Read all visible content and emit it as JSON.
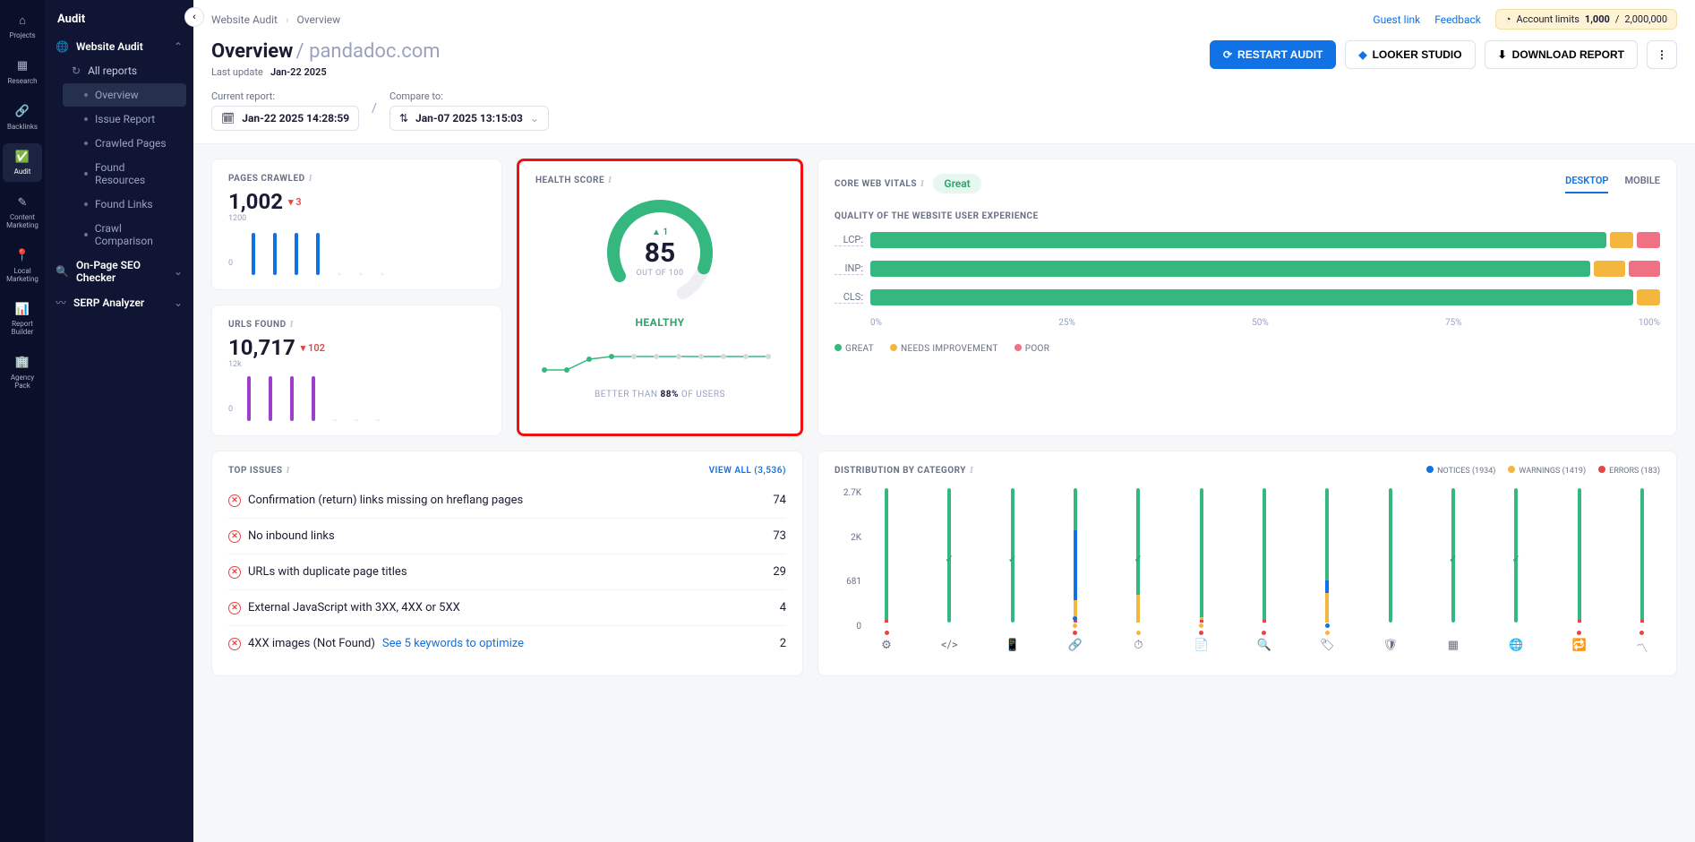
{
  "rail": [
    {
      "id": "projects",
      "label": "Projects"
    },
    {
      "id": "research",
      "label": "Research"
    },
    {
      "id": "backlinks",
      "label": "Backlinks"
    },
    {
      "id": "audit",
      "label": "Audit",
      "active": true
    },
    {
      "id": "content-marketing",
      "label": "Content\nMarketing"
    },
    {
      "id": "local-marketing",
      "label": "Local\nMarketing"
    },
    {
      "id": "report-builder",
      "label": "Report\nBuilder"
    },
    {
      "id": "agency-pack",
      "label": "Agency\nPack"
    }
  ],
  "sidebar": {
    "title": "Audit",
    "sections": [
      {
        "label": "Website Audit",
        "icon": "globe",
        "expanded": true,
        "children": [
          {
            "label": "All reports"
          },
          {
            "label": "Overview",
            "active": true
          },
          {
            "label": "Issue Report"
          },
          {
            "label": "Crawled Pages"
          },
          {
            "label": "Found Resources"
          },
          {
            "label": "Found Links"
          },
          {
            "label": "Crawl Comparison"
          }
        ]
      },
      {
        "label": "On-Page SEO Checker",
        "icon": "search",
        "expanded": false
      },
      {
        "label": "SERP Analyzer",
        "icon": "chart",
        "expanded": false
      }
    ]
  },
  "breadcrumb": {
    "a": "Website Audit",
    "b": "Overview"
  },
  "top_links": {
    "guest": "Guest link",
    "feedback": "Feedback"
  },
  "limits": {
    "label": "Account limits",
    "used": "1,000",
    "total": "2,000,000"
  },
  "title": {
    "page": "Overview",
    "domain": "pandadoc.com"
  },
  "last_update": {
    "label": "Last update",
    "value": "Jan-22 2025"
  },
  "actions": {
    "restart": "RESTART AUDIT",
    "looker": "LOOKER STUDIO",
    "download": "DOWNLOAD REPORT"
  },
  "filters": {
    "current_label": "Current report:",
    "current_value": "Jan-22 2025 14:28:59",
    "compare_label": "Compare to:",
    "compare_value": "Jan-07 2025 13:15:03"
  },
  "pages_crawled": {
    "title": "PAGES CRAWLED",
    "value": "1,002",
    "delta": "3",
    "delta_dir": "down",
    "y_top": "1200",
    "y_bot": "0"
  },
  "urls_found": {
    "title": "URLS FOUND",
    "value": "10,717",
    "delta": "102",
    "delta_dir": "down",
    "y_top": "12k",
    "y_bot": "0"
  },
  "health": {
    "title": "HEALTH SCORE",
    "tick": "▲ 1",
    "score": "85",
    "out_of": "OUT OF 100",
    "status": "HEALTHY",
    "better_prefix": "BETTER THAN ",
    "better_pct": "88%",
    "better_suffix": " OF USERS"
  },
  "cwv": {
    "title": "CORE WEB VITALS",
    "badge": "Great",
    "tabs": {
      "desktop": "DESKTOP",
      "mobile": "MOBILE"
    },
    "subtitle": "QUALITY OF THE WEBSITE USER EXPERIENCE",
    "rows": [
      {
        "label": "LCP:",
        "great": 94,
        "ni": 3,
        "poor": 3
      },
      {
        "label": "INP:",
        "great": 92,
        "ni": 4,
        "poor": 4
      },
      {
        "label": "CLS:",
        "great": 97,
        "ni": 3,
        "poor": 0
      }
    ],
    "axis": [
      "0%",
      "25%",
      "50%",
      "75%",
      "100%"
    ],
    "legend": {
      "great": "GREAT",
      "ni": "NEEDS IMPROVEMENT",
      "poor": "POOR"
    }
  },
  "issues": {
    "title": "TOP ISSUES",
    "view_all": "VIEW ALL (3,536)",
    "rows": [
      {
        "text": "Confirmation (return) links missing on hreflang pages",
        "count": "74"
      },
      {
        "text": "No inbound links",
        "count": "73"
      },
      {
        "text": "URLs with duplicate page titles",
        "count": "29"
      },
      {
        "text": "External JavaScript with 3XX, 4XX or 5XX",
        "count": "4"
      },
      {
        "text": "4XX images (Not Found)",
        "link": "See 5 keywords to optimize",
        "count": "2"
      }
    ]
  },
  "dist": {
    "title": "DISTRIBUTION BY CATEGORY",
    "legend": {
      "notices": "NOTICES (1934)",
      "warnings": "WARNINGS (1419)",
      "errors": "ERRORS (183)"
    },
    "yaxis": [
      "2.7K",
      "2K",
      "681",
      "0"
    ],
    "colors": {
      "errors": "#e64545",
      "warnings": "#f4b63f",
      "notices": "#1072e5",
      "bg": "#35b880"
    }
  },
  "chart_data": [
    {
      "type": "bar",
      "title": "Pages Crawled",
      "ylim": [
        0,
        1200
      ],
      "categories": [
        "1",
        "2",
        "3",
        "4",
        "5",
        "6",
        "7"
      ],
      "values": [
        1000,
        1005,
        1005,
        1002,
        0,
        0,
        0
      ],
      "color": "#1072e5"
    },
    {
      "type": "bar",
      "title": "URLs Found",
      "ylim": [
        0,
        12000
      ],
      "categories": [
        "1",
        "2",
        "3",
        "4",
        "5",
        "6",
        "7"
      ],
      "values": [
        10800,
        10800,
        10800,
        10717,
        0,
        0,
        0
      ],
      "color": "#9b3fcf"
    },
    {
      "type": "line",
      "title": "Health Score trend",
      "ylim": [
        80,
        90
      ],
      "x": [
        1,
        2,
        3,
        4,
        5,
        6,
        7,
        8,
        9,
        10,
        11,
        12
      ],
      "values": [
        82,
        82,
        84,
        85,
        85,
        85,
        85,
        85,
        85,
        85,
        85,
        85
      ]
    },
    {
      "type": "stacked_bar",
      "title": "Distribution by Category",
      "ylim": [
        0,
        2700
      ],
      "categories": [
        "structure",
        "code",
        "mobile",
        "links",
        "performance",
        "content",
        "search",
        "tags",
        "security",
        "markup",
        "international",
        "cache",
        "trend"
      ],
      "series": [
        {
          "name": "errors",
          "values": [
            30,
            0,
            0,
            30,
            0,
            40,
            50,
            0,
            0,
            0,
            0,
            20,
            30
          ]
        },
        {
          "name": "warnings",
          "values": [
            0,
            0,
            0,
            400,
            550,
            50,
            0,
            600,
            0,
            0,
            0,
            0,
            0
          ]
        },
        {
          "name": "notices",
          "values": [
            0,
            0,
            0,
            1400,
            0,
            0,
            0,
            250,
            0,
            0,
            0,
            0,
            0
          ]
        }
      ],
      "checks": [
        false,
        true,
        true,
        false,
        true,
        false,
        false,
        false,
        false,
        true,
        true,
        false,
        false
      ]
    }
  ]
}
